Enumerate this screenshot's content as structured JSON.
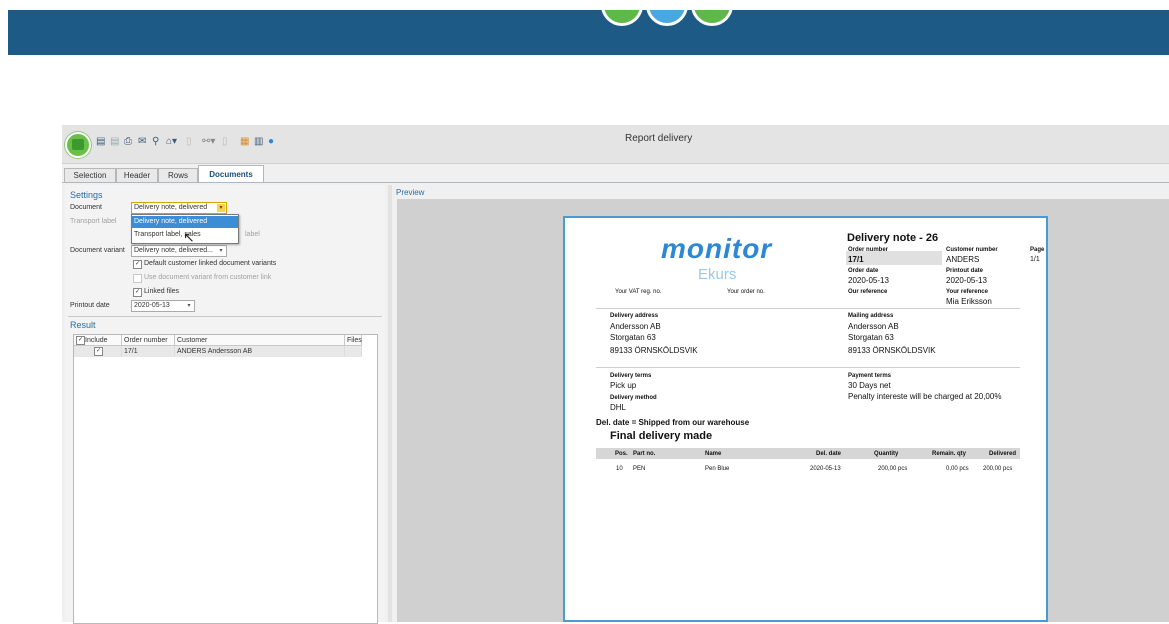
{
  "window": {
    "title": "Report delivery",
    "accent_color": "#2c88d6",
    "banner_color": "#1d5b86",
    "banner_circle_colors": [
      "#5fb84a",
      "#4aa8e0",
      "#5fb84a"
    ]
  },
  "toolbar": {
    "icons": [
      "report-icon",
      "save-icon",
      "print-icon",
      "email-icon",
      "search-icon",
      "home-icon",
      "disabled-icon",
      "link-icon",
      "disabled-icon",
      "grid-icon",
      "export-icon",
      "help-icon"
    ]
  },
  "tabs": [
    {
      "label": "Selection"
    },
    {
      "label": "Header"
    },
    {
      "label": "Rows"
    },
    {
      "label": "Documents",
      "active": true
    }
  ],
  "settings": {
    "title": "Settings",
    "document_label": "Document",
    "document_value": "Delivery note, delivered",
    "transport_label": "Transport label",
    "transport_hidden_suffix": "label",
    "dropdown_options": [
      "Delivery note, delivered",
      "Transport label, sales"
    ],
    "variant_label": "Document variant",
    "variant_value": "Delivery note, delivered...",
    "chk_default": "Default customer linked document variants",
    "chk_default_checked": true,
    "chk_use": "Use document variant from customer link",
    "chk_use_checked": false,
    "chk_linked": "Linked files",
    "chk_linked_checked": true,
    "printout_label": "Printout date",
    "printout_value": "2020-05-13"
  },
  "result": {
    "title": "Result",
    "columns": [
      "Include",
      "Order number",
      "Customer",
      "Files"
    ],
    "include_header_checked": true,
    "rows": [
      {
        "include": true,
        "order": "17/1",
        "customer": "ANDERS  Andersson AB",
        "files": ""
      }
    ]
  },
  "preview": {
    "label": "Preview",
    "logo_main": "monitor",
    "logo_sub": "Ekurs",
    "doc_title": "Delivery note - 26",
    "order_number_label": "Order number",
    "order_number": "17/1",
    "customer_number_label": "Customer number",
    "customer_number": "ANDERS",
    "page_label": "Page",
    "page": "1/1",
    "order_date_label": "Order date",
    "order_date": "2020-05-13",
    "printout_date_label": "Printout date",
    "printout_date": "2020-05-13",
    "vat_label": "Your VAT reg. no.",
    "your_order_label": "Your order no.",
    "our_ref_label": "Our reference",
    "your_ref_label": "Your reference",
    "your_ref": "Mia Eriksson",
    "delivery_address_label": "Delivery address",
    "delivery_address": [
      "Andersson AB",
      "Storgatan 63",
      "89133 ÖRNSKÖLDSVIK"
    ],
    "mailing_address_label": "Mailing address",
    "mailing_address": [
      "Andersson AB",
      "Storgatan 63",
      "89133 ÖRNSKÖLDSVIK"
    ],
    "delivery_terms_label": "Delivery terms",
    "delivery_terms": "Pick up",
    "delivery_method_label": "Delivery method",
    "delivery_method": "DHL",
    "payment_terms_label": "Payment terms",
    "payment_terms": "30 Days net",
    "penalty": "Penalty intereste will be charged at 20,00%",
    "del_date_note": "Del. date = Shipped from our warehouse",
    "final_delivery": "Final delivery made",
    "table_headers": [
      "Pos.",
      "Part no.",
      "Name",
      "Del. date",
      "Quantity",
      "Remain. qty",
      "Delivered"
    ],
    "table_rows": [
      {
        "pos": "10",
        "part": "PEN",
        "name": "Pen Blue",
        "del_date": "2020-05-13",
        "quantity": "200,00 pcs",
        "remain": "0,00 pcs",
        "delivered": "200,00 pcs"
      }
    ]
  }
}
